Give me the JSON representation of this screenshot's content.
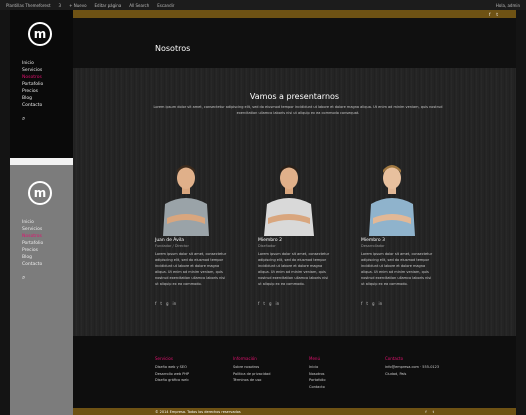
{
  "adminbar": {
    "items": [
      "Plantillas Themeforest",
      "3",
      "+ Nuevo",
      "Editar página",
      "All Search",
      "Escandir"
    ],
    "right": "Hola, admin"
  },
  "sidebar": {
    "logo": "m",
    "nav": [
      "Inicio",
      "Servicios",
      "Nosotros",
      "Portafolio",
      "Precios",
      "Blog",
      "Contacto"
    ],
    "active": "Nosotros",
    "search_icon": "⌕"
  },
  "topbar": {
    "icons": [
      "f",
      "t"
    ]
  },
  "page": {
    "title": "Nosotros"
  },
  "section": {
    "title": "Vamos a presentarnos",
    "intro": "Lorem ipsum dolor sit amet, consectetur adipiscing elit, sed do eiusmod tempor incididunt ut labore et dolore magna aliqua. Ut enim ad minim veniam, quis nostrud exercitation ullamco laboris nisi ut aliquip ex ea commodo consequat."
  },
  "team": [
    {
      "name": "Juan de Ávila",
      "role": "Fundador / Director",
      "bio": "Lorem ipsum dolor sit amet, consectetur adipiscing elit, sed do eiusmod tempor incididunt ut labore et dolore magna aliqua. Ut enim ad minim veniam, quis nostrud exercitation ullamco laboris nisi ut aliquip ex ea commodo.",
      "social": [
        "f",
        "t",
        "g",
        "in"
      ],
      "shirt": "#9aa3a8"
    },
    {
      "name": "Miembro 2",
      "role": "Diseñador",
      "bio": "Lorem ipsum dolor sit amet, consectetur adipiscing elit, sed do eiusmod tempor incididunt ut labore et dolore magna aliqua. Ut enim ad minim veniam, quis nostrud exercitation ullamco laboris nisi ut aliquip ex ea commodo.",
      "social": [
        "f",
        "t",
        "g",
        "in"
      ],
      "shirt": "#d9d9d9"
    },
    {
      "name": "Miembro 3",
      "role": "Desarrollador",
      "bio": "Lorem ipsum dolor sit amet, consectetur adipiscing elit, sed do eiusmod tempor incididunt ut labore et dolore magna aliqua. Ut enim ad minim veniam, quis nostrud exercitation ullamco laboris nisi ut aliquip ex ea commodo.",
      "social": [
        "f",
        "t",
        "g",
        "in"
      ],
      "shirt": "#8fb3cc"
    }
  ],
  "footer": {
    "columns": [
      {
        "title": "Servicios",
        "items": [
          "Diseño web y SEO",
          "Desarrollo web PHP",
          "Diseño gráfico web"
        ]
      },
      {
        "title": "Información",
        "items": [
          "Sobre nosotros",
          "Política de privacidad",
          "Términos de uso"
        ]
      },
      {
        "title": "Menú",
        "items": [
          "Inicio",
          "Nosotros",
          "Portafolio",
          "Contacto"
        ]
      },
      {
        "title": "Contacto",
        "items": [
          "info@empresa.com · 555-0123",
          "Ciudad, País"
        ]
      }
    ]
  },
  "bottom": {
    "text": "© 2014 Empresa. Todos los derechos reservados",
    "icons": [
      "f",
      "t"
    ]
  },
  "colors": {
    "accent": "#e2116f",
    "gold": "#6e5214"
  }
}
